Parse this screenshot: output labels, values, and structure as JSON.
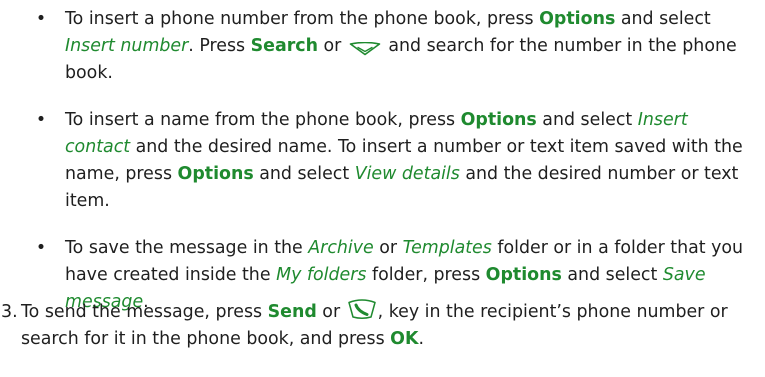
{
  "bullets": [
    {
      "t1": "To insert a phone number from the phone book, press ",
      "k1": "Options",
      "t2": " and select ",
      "e1": "Insert number",
      "t3": ". Press ",
      "k2": "Search",
      "t4": " or ",
      "icon": "scroll-down-key-icon",
      "t5": " and search for the number in the phone book."
    },
    {
      "t1": "To insert a name from the phone book, press ",
      "k1": "Options",
      "t2": " and select ",
      "e1": "Insert contact",
      "t3": " and the desired name. To insert a number or text item saved with the name, press ",
      "k2": "Options",
      "t4": " and select ",
      "e2": "View details",
      "t5": " and the desired number or text item."
    },
    {
      "t1": "To save the message in the ",
      "e1": "Archive",
      "t2": " or ",
      "e2": "Templates",
      "t3": " folder or in a folder that you have created inside the ",
      "e3": "My folders",
      "t4": " folder, press ",
      "k1": "Options",
      "t5": " and select ",
      "e4": "Save message",
      "t6": "."
    }
  ],
  "step3": {
    "number": "3.",
    "t1": "To send the message, press ",
    "k1": "Send",
    "t2": " or ",
    "icon": "call-key-icon",
    "t3": ", key in the recipient’s phone number or search for it in the phone book, and press ",
    "k2": "OK",
    "t4": "."
  },
  "colors": {
    "accent": "#1f8a2f",
    "text": "#1f1f1f"
  }
}
